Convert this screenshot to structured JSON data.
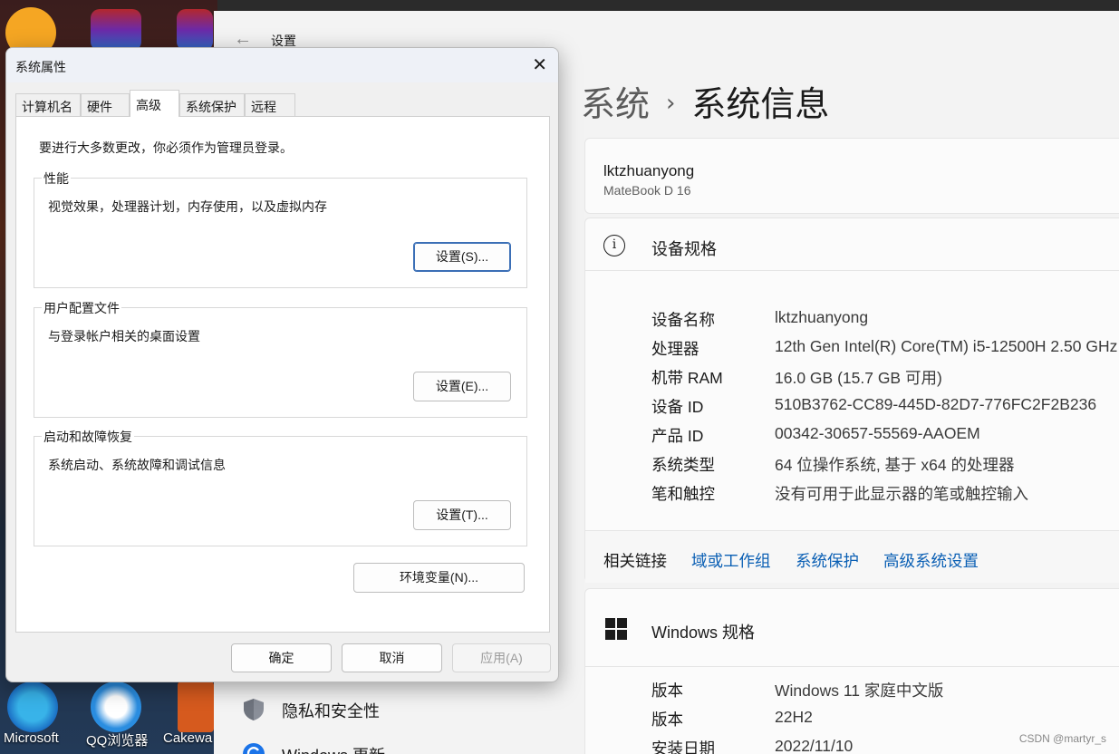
{
  "desktop": {
    "icons": [
      {
        "label": "Microsoft",
        "color": "#1e7bd6"
      },
      {
        "label": "QQ浏览器",
        "color": "#2a8de0"
      },
      {
        "label": "Cakewa",
        "color": "#d65a1e"
      }
    ]
  },
  "settings": {
    "window_title": "设置",
    "breadcrumb": {
      "parent": "系统",
      "current": "系统信息"
    },
    "device": {
      "name": "lktzhuanyong",
      "model": "MateBook D 16"
    },
    "device_specs": {
      "title": "设备规格",
      "rows": [
        {
          "key": "设备名称",
          "value": "lktzhuanyong"
        },
        {
          "key": "处理器",
          "value": "12th Gen Intel(R) Core(TM) i5-12500H   2.50 GHz"
        },
        {
          "key": "机带 RAM",
          "value": "16.0 GB (15.7 GB 可用)"
        },
        {
          "key": "设备 ID",
          "value": "510B3762-CC89-445D-82D7-776FC2F2B236"
        },
        {
          "key": "产品 ID",
          "value": "00342-30657-55569-AAOEM"
        },
        {
          "key": "系统类型",
          "value": "64 位操作系统, 基于 x64 的处理器"
        },
        {
          "key": "笔和触控",
          "value": "没有可用于此显示器的笔或触控输入"
        }
      ]
    },
    "related_links": {
      "label": "相关链接",
      "links": [
        "域或工作组",
        "系统保护",
        "高级系统设置"
      ]
    },
    "windows_specs": {
      "title": "Windows 规格",
      "rows": [
        {
          "key": "版本",
          "value": "Windows 11 家庭中文版"
        },
        {
          "key": "版本",
          "value": "22H2"
        },
        {
          "key": "安装日期",
          "value": "2022/11/10"
        }
      ]
    },
    "nav": [
      {
        "label": "隐私和安全性",
        "icon": "shield-icon"
      },
      {
        "label": "Windows 更新",
        "icon": "update-icon"
      }
    ],
    "link_color": "#0a5fb4",
    "watermark": "CSDN @martyr_s"
  },
  "dialog": {
    "title": "系统属性",
    "tabs": [
      "计算机名",
      "硬件",
      "高级",
      "系统保护",
      "远程"
    ],
    "active_tab": "高级",
    "admin_note": "要进行大多数更改，你必须作为管理员登录。",
    "groups": [
      {
        "label": "性能",
        "desc": "视觉效果，处理器计划，内存使用，以及虚拟内存",
        "button": "设置(S)..."
      },
      {
        "label": "用户配置文件",
        "desc": "与登录帐户相关的桌面设置",
        "button": "设置(E)..."
      },
      {
        "label": "启动和故障恢复",
        "desc": "系统启动、系统故障和调试信息",
        "button": "设置(T)..."
      }
    ],
    "env_button": "环境变量(N)...",
    "ok": "确定",
    "cancel": "取消",
    "apply": "应用(A)"
  }
}
